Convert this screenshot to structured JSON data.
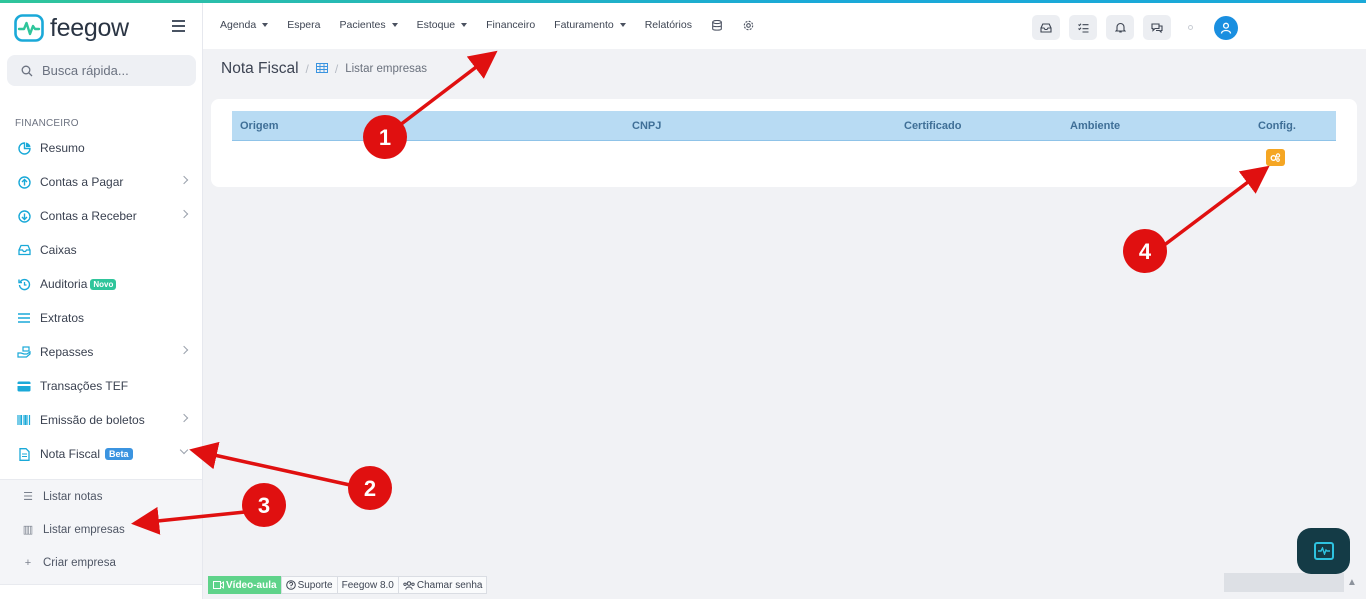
{
  "colors": {
    "accent": "#1aa9d8",
    "brand_green": "#2fc59b",
    "table_header_bg": "#b8dbf3",
    "config_button": "#f5a623",
    "annotation_red": "#e01010"
  },
  "brand": {
    "name": "feegow",
    "logo_icon": "heart-monitor-icon"
  },
  "search": {
    "placeholder": "Busca rápida..."
  },
  "topnav": {
    "items": [
      {
        "label": "Agenda",
        "dropdown": true
      },
      {
        "label": "Espera",
        "dropdown": false
      },
      {
        "label": "Pacientes",
        "dropdown": true
      },
      {
        "label": "Estoque",
        "dropdown": true
      },
      {
        "label": "Financeiro",
        "dropdown": false
      },
      {
        "label": "Faturamento",
        "dropdown": true
      },
      {
        "label": "Relatórios",
        "dropdown": false
      }
    ],
    "icons": [
      "database-icon",
      "settings-icon"
    ],
    "tools": [
      "inbox-icon",
      "checklist-icon",
      "bell-icon",
      "chat-icon"
    ]
  },
  "sidebar": {
    "section": "FINANCEIRO",
    "items": [
      {
        "label": "Resumo",
        "icon": "pie-chart-icon",
        "chevron": false
      },
      {
        "label": "Contas a Pagar",
        "icon": "arrow-up-circle-icon",
        "chevron": true
      },
      {
        "label": "Contas a Receber",
        "icon": "arrow-down-circle-icon",
        "chevron": true
      },
      {
        "label": "Caixas",
        "icon": "inbox-icon",
        "chevron": false
      },
      {
        "label": "Auditoria",
        "icon": "history-icon",
        "chevron": false,
        "badge": "Novo"
      },
      {
        "label": "Extratos",
        "icon": "list-icon",
        "chevron": false
      },
      {
        "label": "Repasses",
        "icon": "hand-money-icon",
        "chevron": true
      },
      {
        "label": "Transações TEF",
        "icon": "credit-card-icon",
        "chevron": false
      },
      {
        "label": "Emissão de boletos",
        "icon": "barcode-icon",
        "chevron": true
      },
      {
        "label": "Nota Fiscal",
        "icon": "document-icon",
        "chevron": true,
        "badge": "Beta",
        "expanded": true
      }
    ],
    "subitems": [
      {
        "label": "Listar notas",
        "icon": "list-icon"
      },
      {
        "label": "Listar empresas",
        "icon": "building-icon"
      },
      {
        "label": "Criar empresa",
        "icon": "plus-icon"
      }
    ]
  },
  "breadcrumb": {
    "title": "Nota Fiscal",
    "sep": "/",
    "leaf": "Listar empresas",
    "icon": "table-icon"
  },
  "table": {
    "columns": [
      "Origem",
      "CNPJ",
      "Certificado",
      "Ambiente",
      "Config."
    ],
    "config_icon": "cogs-icon"
  },
  "footer": {
    "video": "Vídeo-aula",
    "support": "Suporte",
    "version": "Feegow 8.0",
    "call": "Chamar senha"
  },
  "annotations": [
    "1",
    "2",
    "3",
    "4"
  ]
}
